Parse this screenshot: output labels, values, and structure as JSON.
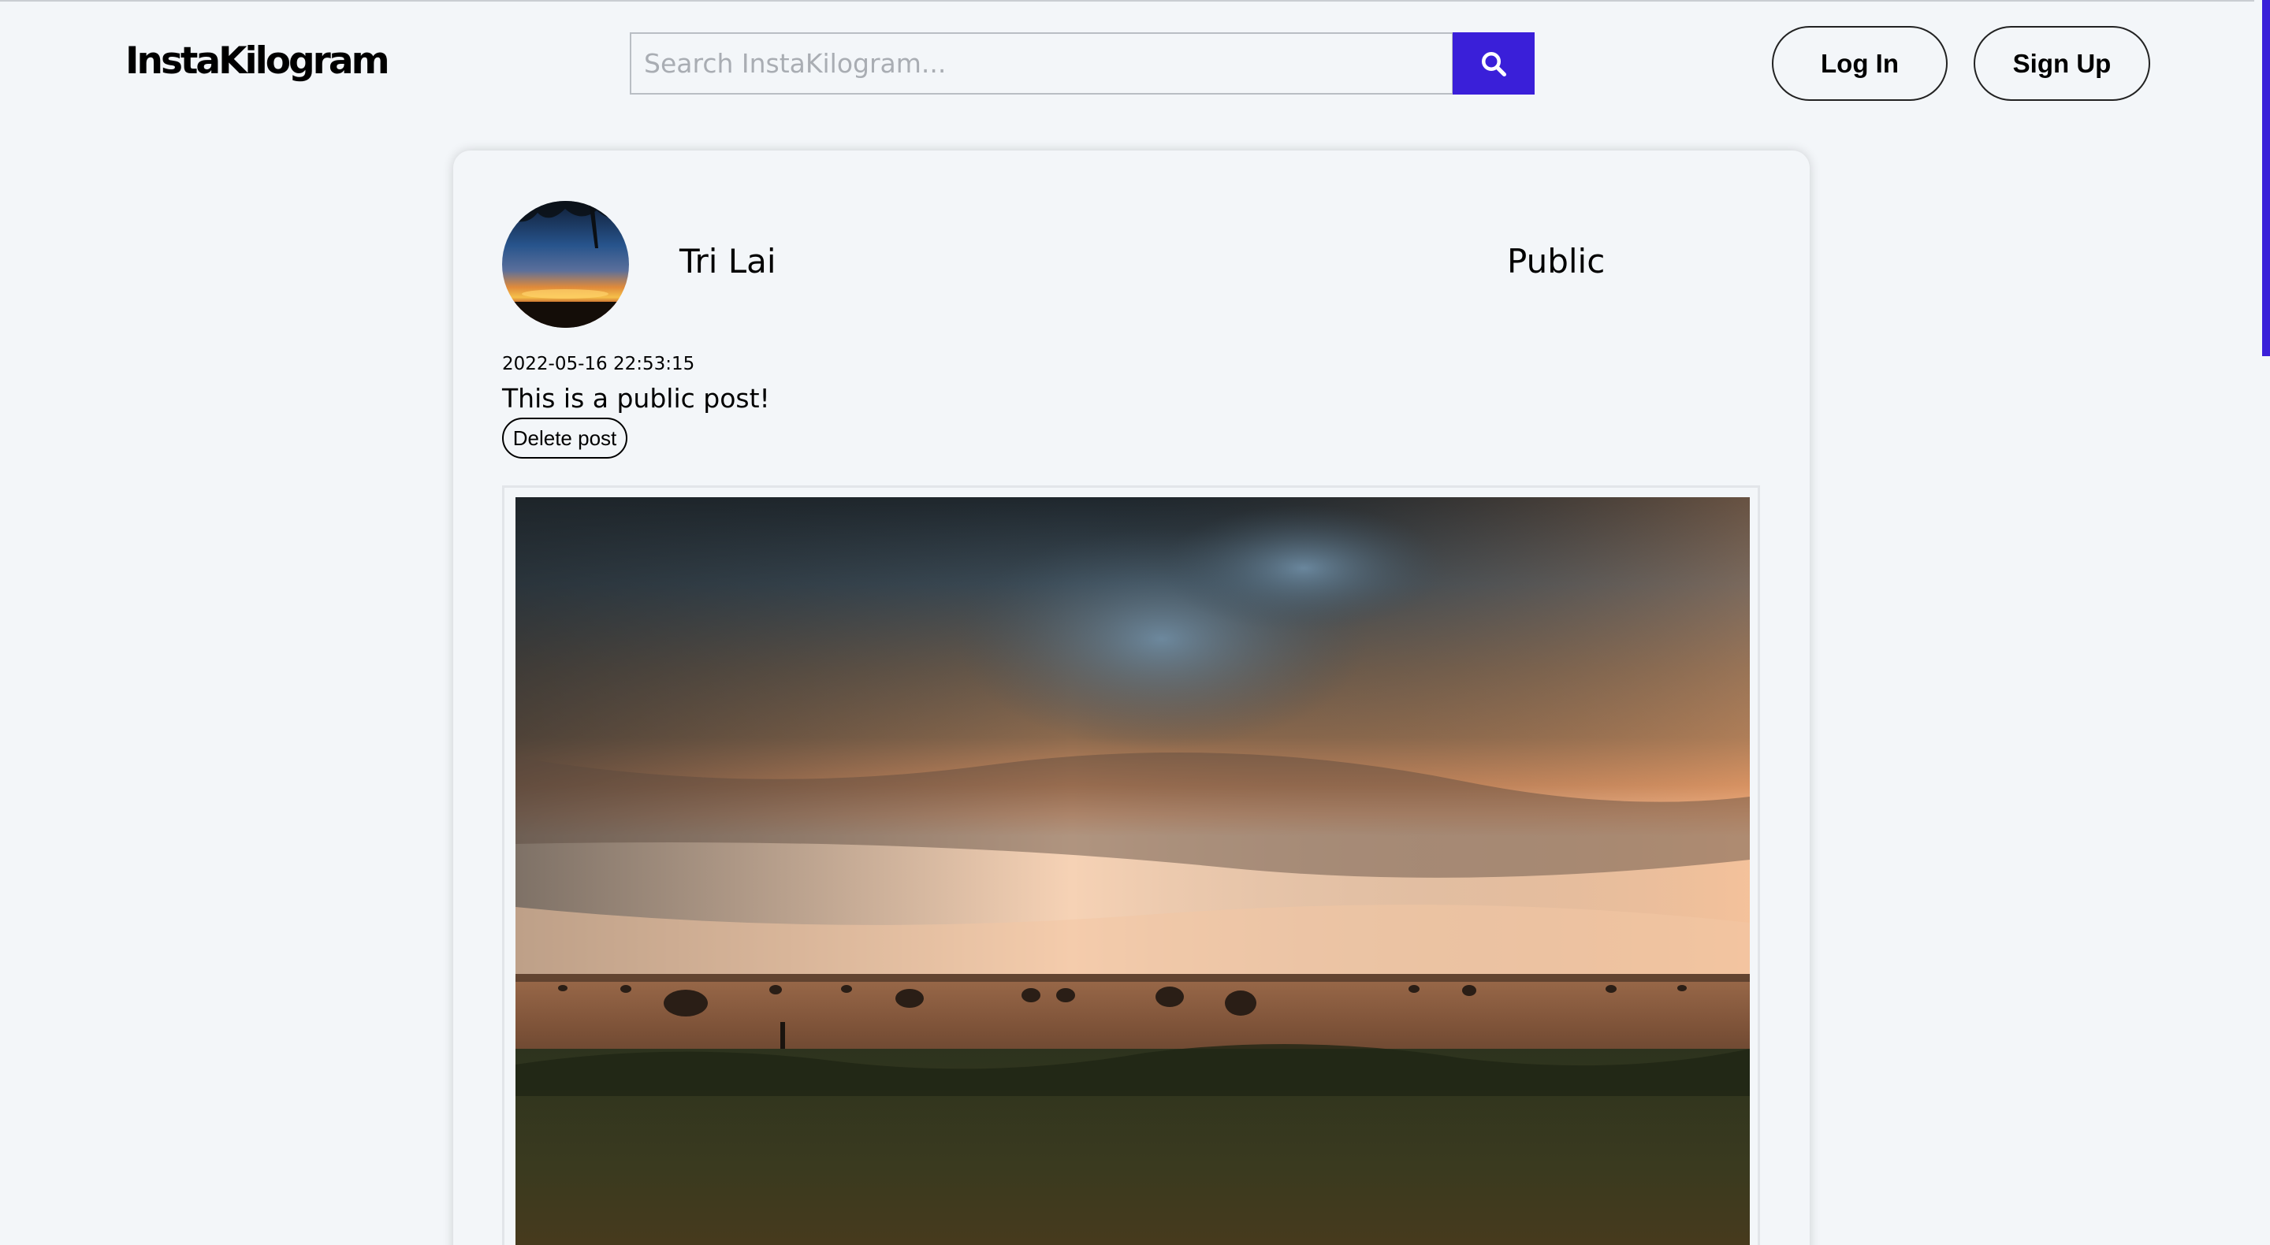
{
  "header": {
    "logo": "InstaKilogram",
    "search_placeholder": "Search InstaKilogram...",
    "login_label": "Log In",
    "signup_label": "Sign Up"
  },
  "post": {
    "author": "Tri Lai",
    "visibility": "Public",
    "timestamp": "2022-05-16 22:53:15",
    "caption": "This is a public post!",
    "delete_label": "Delete post"
  },
  "colors": {
    "accent": "#3a1fd9",
    "background": "#f3f6f9"
  },
  "icons": {
    "search": "search-icon"
  }
}
